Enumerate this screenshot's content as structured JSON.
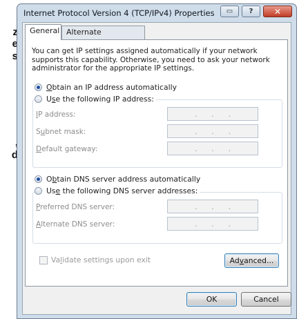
{
  "background_fragments": [
    "z",
    "e",
    "s",
    ",",
    "d"
  ],
  "dialog": {
    "title": "Internet Protocol Version 4 (TCP/IPv4) Properties",
    "window_buttons": {
      "restore": "▭",
      "help": "?",
      "close": "✕"
    },
    "tabs": [
      {
        "label": "General",
        "selected": true
      },
      {
        "label": "Alternate Configuration",
        "selected": false
      }
    ],
    "intro_text": "You can get IP settings assigned automatically if your network supports this capability. Otherwise, you need to ask your network administrator for the appropriate IP settings.",
    "ip_section": {
      "auto_option": {
        "prefix": "",
        "accel": "O",
        "rest": "btain an IP address automatically",
        "selected": true
      },
      "manual_option": {
        "prefix": "U",
        "accel": "s",
        "rest": "e the following IP address:",
        "selected": false
      },
      "fields": [
        {
          "prefix": "",
          "accel": "I",
          "rest": "P address:",
          "value": ". . ."
        },
        {
          "prefix": "S",
          "accel": "u",
          "rest": "bnet mask:",
          "value": ". . ."
        },
        {
          "prefix": "",
          "accel": "D",
          "rest": "efault gateway:",
          "value": ". . ."
        }
      ]
    },
    "dns_section": {
      "auto_option": {
        "prefix": "O",
        "accel": "b",
        "rest": "tain DNS server address automatically",
        "selected": true
      },
      "manual_option": {
        "prefix": "Us",
        "accel": "e",
        "rest": " the following DNS server addresses:",
        "selected": false
      },
      "fields": [
        {
          "prefix": "",
          "accel": "P",
          "rest": "referred DNS server:",
          "value": ". . ."
        },
        {
          "prefix": "",
          "accel": "A",
          "rest": "lternate DNS server:",
          "value": ". . ."
        }
      ]
    },
    "validate": {
      "prefix": "Va",
      "accel": "l",
      "rest": "idate settings upon exit",
      "checked": false
    },
    "advanced_button": {
      "prefix": "Ad",
      "accel": "v",
      "rest": "anced..."
    },
    "ok_button": "OK",
    "cancel_button": "Cancel"
  }
}
